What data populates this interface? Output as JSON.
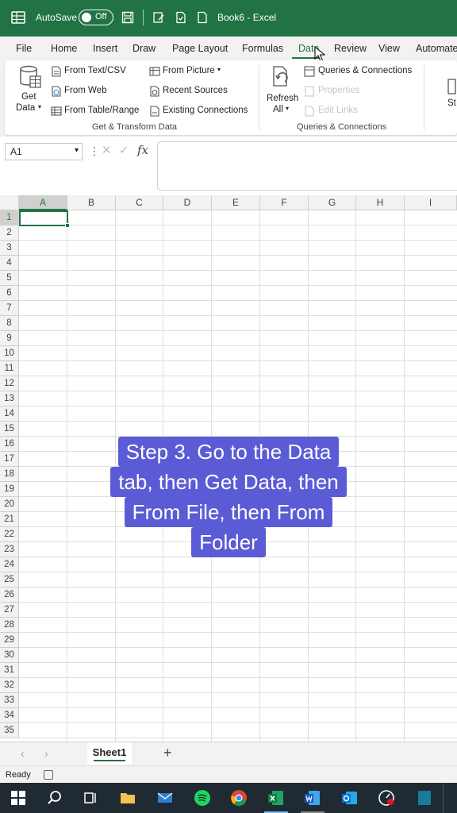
{
  "titlebar": {
    "autosave_label": "AutoSave",
    "autosave_state": "Off",
    "doc_title": "Book6  -  Excel"
  },
  "tabs": [
    {
      "label": "File"
    },
    {
      "label": "Home"
    },
    {
      "label": "Insert"
    },
    {
      "label": "Draw"
    },
    {
      "label": "Page Layout"
    },
    {
      "label": "Formulas"
    },
    {
      "label": "Data"
    },
    {
      "label": "Review"
    },
    {
      "label": "View"
    },
    {
      "label": "Automate"
    }
  ],
  "ribbon": {
    "get_data_line1": "Get",
    "get_data_line2": "Data",
    "from_text_csv": "From Text/CSV",
    "from_web": "From Web",
    "from_table_range": "From Table/Range",
    "from_picture": "From Picture",
    "recent_sources": "Recent Sources",
    "existing_connections": "Existing Connections",
    "group_get_transform": "Get & Transform Data",
    "refresh_line1": "Refresh",
    "refresh_line2": "All",
    "queries_connections": "Queries & Connections",
    "properties": "Properties",
    "edit_links": "Edit Links",
    "group_queries": "Queries & Connections",
    "cut_off_label": "St"
  },
  "formula_bar": {
    "name_box": "A1",
    "fx": "fx"
  },
  "grid": {
    "columns": [
      "A",
      "B",
      "C",
      "D",
      "E",
      "F",
      "G",
      "H",
      "I"
    ],
    "rows": [
      "1",
      "2",
      "3",
      "4",
      "5",
      "6",
      "7",
      "8",
      "9",
      "10",
      "11",
      "12",
      "13",
      "14",
      "15",
      "16",
      "17",
      "18",
      "19",
      "20",
      "21",
      "22",
      "23",
      "24",
      "25",
      "26",
      "27",
      "28",
      "29",
      "30",
      "31",
      "32",
      "33",
      "34",
      "35"
    ]
  },
  "caption": {
    "lines": [
      "Step 3. Go to the Data",
      "tab, then Get Data, then",
      "From File, then From",
      "Folder"
    ]
  },
  "sheets": {
    "active": "Sheet1",
    "add": "+"
  },
  "status": {
    "text": "Ready"
  },
  "colors": {
    "excel_green": "#217346",
    "caption_bg": "#5b5bd6"
  }
}
